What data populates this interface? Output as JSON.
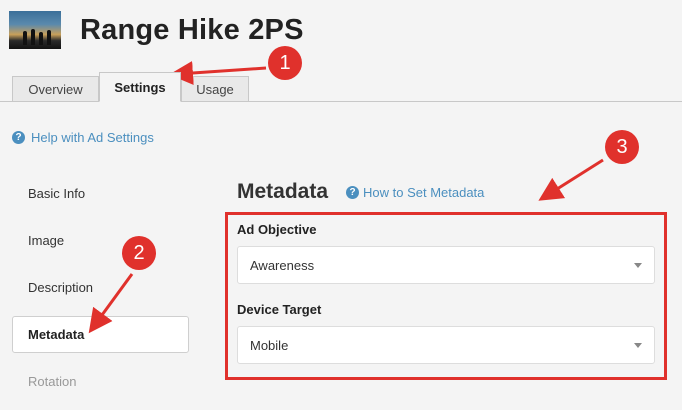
{
  "header": {
    "thumbnail_icon": "hikers-photo-icon",
    "title": "Range Hike 2PS"
  },
  "tabs": [
    {
      "label": "Overview",
      "active": false
    },
    {
      "label": "Settings",
      "active": true
    },
    {
      "label": "Usage",
      "active": false
    }
  ],
  "help_link": {
    "icon": "question-circle-icon",
    "label": "Help with Ad Settings"
  },
  "sidebar": {
    "items": [
      {
        "label": "Basic Info"
      },
      {
        "label": "Image"
      },
      {
        "label": "Description"
      },
      {
        "label": "Metadata",
        "active": true
      },
      {
        "label": "Rotation",
        "disabled": true
      }
    ]
  },
  "metadata": {
    "title": "Metadata",
    "howto_link": "How to Set Metadata",
    "ad_objective": {
      "label": "Ad Objective",
      "value": "Awareness"
    },
    "device_target": {
      "label": "Device Target",
      "value": "Mobile"
    }
  },
  "annotations": {
    "badge_1": "1",
    "badge_2": "2",
    "badge_3": "3",
    "color": "#e0312c"
  },
  "colors": {
    "link": "#4b8fbf",
    "background": "#f4f4f4"
  }
}
